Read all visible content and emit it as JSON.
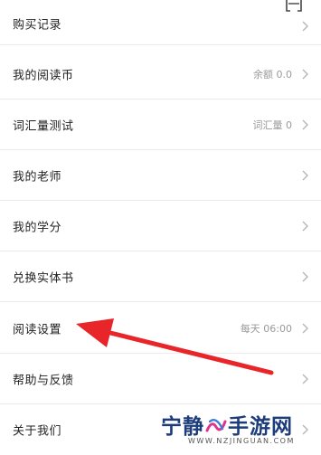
{
  "menu": {
    "items": [
      {
        "label": "购买记录",
        "value": ""
      },
      {
        "label": "我的阅读币",
        "value": "余额 0.0"
      },
      {
        "label": "词汇量测试",
        "value": "词汇量 0"
      },
      {
        "label": "我的老师",
        "value": ""
      },
      {
        "label": "我的学分",
        "value": ""
      },
      {
        "label": "兑换实体书",
        "value": ""
      },
      {
        "label": "阅读设置",
        "value": "每天 06:00"
      },
      {
        "label": "帮助与反馈",
        "value": ""
      },
      {
        "label": "关于我们",
        "value": ""
      }
    ]
  },
  "icons": {
    "top_right": "scan-icon",
    "row_end": "chevron-right-icon"
  },
  "annotation": {
    "type": "red-arrow",
    "points_to": "阅读设置",
    "color": "#e8262a"
  },
  "watermark": {
    "title_left": "宁静",
    "title_right": "手游网",
    "url": "WWW.NZJINGUAN.COM"
  },
  "colors": {
    "label": "#222222",
    "value": "#9a9a9a",
    "divider": "#ececec",
    "arrow": "#e8262a",
    "watermark_text": "#1d3c7a"
  }
}
